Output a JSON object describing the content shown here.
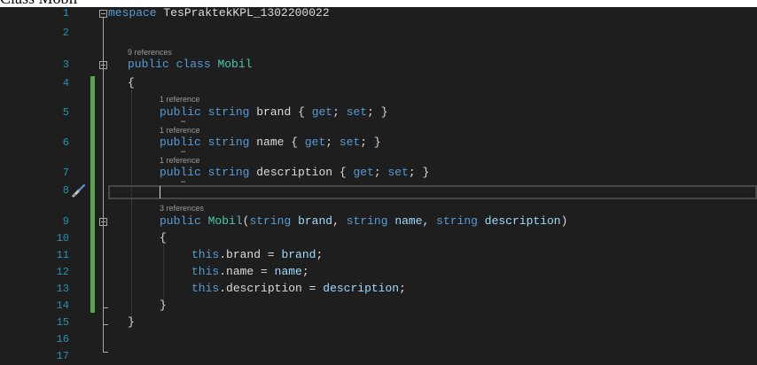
{
  "header": {
    "title": "Class Mobil"
  },
  "editor": {
    "line_numbers": [
      "1",
      "2",
      "3",
      "4",
      "5",
      "6",
      "7",
      "8",
      "9",
      "10",
      "11",
      "12",
      "13",
      "14",
      "15",
      "16",
      "17"
    ],
    "code_lens": {
      "class_refs": "9 references",
      "brand_refs": "1 reference",
      "name_refs": "1 reference",
      "desc_refs": "1 reference",
      "ctor_refs": "3 references"
    },
    "code": {
      "l1_kw": "mespace",
      "l1_name": " TesPraktekKPL_1302200022",
      "l3_kw": "public class",
      "l3_type": "Mobil",
      "l4": "{",
      "l5_kw": "public string",
      "l5_prop": "brand",
      "l5_open": "{",
      "l5_get": "get",
      "l5_set": "set",
      "l5_close": "}",
      "l6_kw": "public string",
      "l6_prop": "name",
      "l7_kw": "public string",
      "l7_prop": "description",
      "l9_kw": "public",
      "l9_type": "Mobil",
      "l9_p_kw1": "string",
      "l9_p1": "brand",
      "l9_p_kw2": "string",
      "l9_p2": "name",
      "l9_p_kw3": "string",
      "l9_p3": "description",
      "l10": "{",
      "l11_this": "this",
      "l11_member": "brand",
      "l11_value": "brand",
      "l12_this": "this",
      "l12_member": "name",
      "l12_value": "name",
      "l13_this": "this",
      "l13_member": "description",
      "l13_value": "description",
      "l14": "}",
      "l15": "}"
    },
    "colors": {
      "keyword": "#569cd6",
      "type": "#4ec9b0",
      "identifier": "#9cdcfe",
      "plain": "#dcdcdc",
      "line_number": "#2b91af",
      "change_bar": "#57a64a"
    },
    "icons": [
      "screwdriver-brush-icon"
    ]
  }
}
